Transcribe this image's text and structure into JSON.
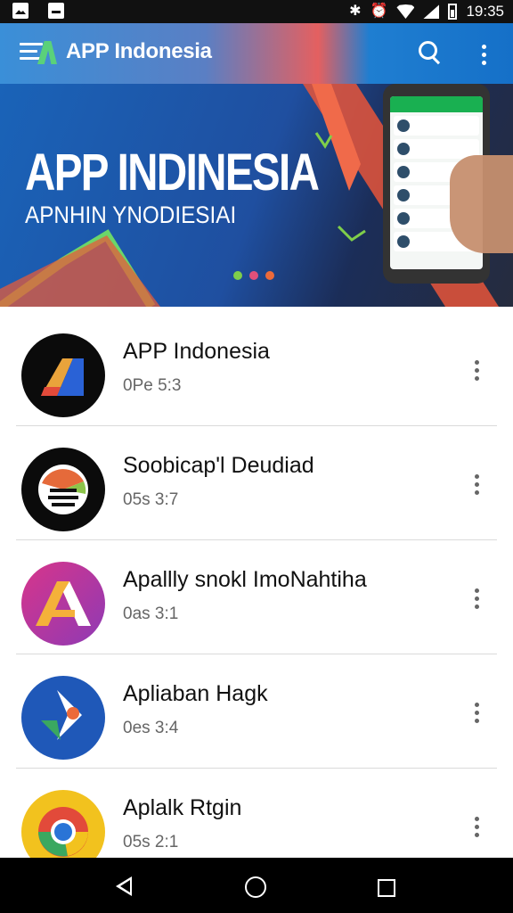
{
  "statusbar": {
    "time": "19:35",
    "icons": [
      "photo-icon",
      "message-icon",
      "bluetooth-icon",
      "alarm-icon",
      "wifi-icon",
      "signal-icon",
      "battery-icon"
    ]
  },
  "appbar": {
    "title": "APP Indonesia",
    "actions": [
      "search-icon",
      "overflow-menu-icon"
    ]
  },
  "banner": {
    "title": "APP INDINESIA",
    "subtitle": "APNHIN YNODIESIAI",
    "dot_colors": [
      "#7fce4a",
      "#e0507a",
      "#ec6a3a"
    ]
  },
  "list": {
    "items": [
      {
        "title": "APP Indonesia",
        "subtitle": "0Pe 5:3"
      },
      {
        "title": "Soobicap'l Deudiad",
        "subtitle": "05s 3:7"
      },
      {
        "title": "Apallly snokl ImoNahtiha",
        "subtitle": "0as 3:1"
      },
      {
        "title": "Apliaban Hagk",
        "subtitle": "0es 3:4"
      },
      {
        "title": "Aplalk Rtgin",
        "subtitle": "05s 2:1"
      }
    ]
  },
  "navbar": {
    "buttons": [
      "back-icon",
      "home-icon",
      "recents-icon"
    ]
  },
  "colors": {
    "appbar_accent": "#1f7ed1",
    "banner_accent": "#1a63b8",
    "divider": "#dadada"
  }
}
